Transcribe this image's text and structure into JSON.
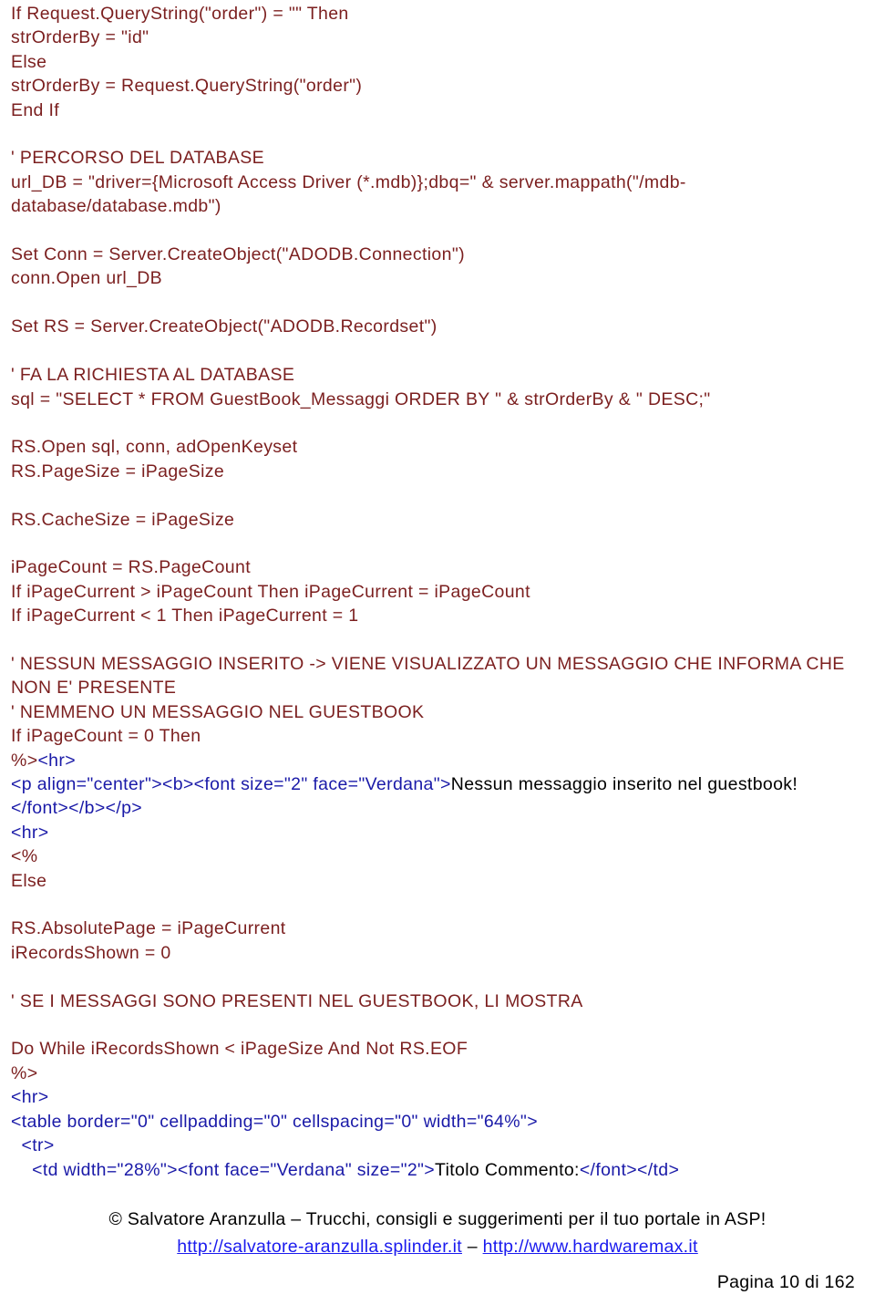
{
  "document": {
    "kind": "asp-code-listing",
    "colors": {
      "vbscript": "#7b1f1f",
      "html_tag": "#1a1aa8",
      "literal_text": "#000000",
      "link": "#1a1aee",
      "background": "#ffffff"
    }
  },
  "code": {
    "lines": [
      {
        "id": "l1",
        "kind": "vbs",
        "text": "If Request.QueryString(\"order\") = \"\" Then"
      },
      {
        "id": "l2",
        "kind": "vbs",
        "text": "strOrderBy = \"id\""
      },
      {
        "id": "l3",
        "kind": "vbs",
        "text": "Else"
      },
      {
        "id": "l4",
        "kind": "vbs",
        "text": "strOrderBy = Request.QueryString(\"order\")"
      },
      {
        "id": "l5",
        "kind": "vbs",
        "text": "End If"
      },
      {
        "id": "l6",
        "kind": "blank",
        "text": ""
      },
      {
        "id": "l7",
        "kind": "vbs",
        "text": "' PERCORSO DEL DATABASE"
      },
      {
        "id": "l8",
        "kind": "vbs",
        "text": "url_DB = \"driver={Microsoft Access Driver (*.mdb)};dbq=\" & server.mappath(\"/mdb-database/database.mdb\")"
      },
      {
        "id": "l9",
        "kind": "blank",
        "text": ""
      },
      {
        "id": "l10",
        "kind": "vbs",
        "text": "Set Conn = Server.CreateObject(\"ADODB.Connection\")"
      },
      {
        "id": "l11",
        "kind": "vbs",
        "text": "conn.Open url_DB"
      },
      {
        "id": "l12",
        "kind": "blank",
        "text": ""
      },
      {
        "id": "l13",
        "kind": "vbs",
        "text": "Set RS = Server.CreateObject(\"ADODB.Recordset\")"
      },
      {
        "id": "l14",
        "kind": "blank",
        "text": ""
      },
      {
        "id": "l15",
        "kind": "vbs",
        "text": "' FA LA RICHIESTA AL DATABASE"
      },
      {
        "id": "l16",
        "kind": "vbs",
        "text": "sql = \"SELECT * FROM GuestBook_Messaggi ORDER BY \" & strOrderBy & \" DESC;\""
      },
      {
        "id": "l17",
        "kind": "blank",
        "text": ""
      },
      {
        "id": "l18",
        "kind": "vbs",
        "text": "RS.Open sql, conn, adOpenKeyset"
      },
      {
        "id": "l19",
        "kind": "vbs",
        "text": "RS.PageSize = iPageSize"
      },
      {
        "id": "l20",
        "kind": "blank",
        "text": ""
      },
      {
        "id": "l21",
        "kind": "vbs",
        "text": "RS.CacheSize = iPageSize"
      },
      {
        "id": "l22",
        "kind": "blank",
        "text": ""
      },
      {
        "id": "l23",
        "kind": "vbs",
        "text": "iPageCount = RS.PageCount"
      },
      {
        "id": "l24",
        "kind": "vbs",
        "text": "If iPageCurrent > iPageCount Then iPageCurrent = iPageCount"
      },
      {
        "id": "l25",
        "kind": "vbs",
        "text": "If iPageCurrent < 1 Then iPageCurrent = 1"
      },
      {
        "id": "l26",
        "kind": "blank",
        "text": ""
      },
      {
        "id": "l27",
        "kind": "vbs",
        "text": "' NESSUN MESSAGGIO INSERITO -> VIENE VISUALIZZATO UN MESSAGGIO CHE INFORMA CHE NON E' PRESENTE"
      },
      {
        "id": "l28",
        "kind": "vbs",
        "text": "' NEMMENO UN MESSAGGIO NEL GUESTBOOK"
      },
      {
        "id": "l29",
        "kind": "vbs",
        "text": "If iPageCount = 0 Then"
      },
      {
        "id": "l30",
        "kind": "mixed",
        "parts": [
          {
            "c": "vbs",
            "t": "%>"
          },
          {
            "c": "html",
            "t": "<hr>"
          }
        ]
      },
      {
        "id": "l31",
        "kind": "mixed",
        "parts": [
          {
            "c": "html",
            "t": "<p align=\"center\"><b><font size=\"2\" face=\"Verdana\">"
          },
          {
            "c": "text",
            "t": "Nessun messaggio inserito nel guestbook!"
          },
          {
            "c": "html",
            "t": "</font></b></p>"
          }
        ]
      },
      {
        "id": "l32",
        "kind": "html",
        "text": "<hr>"
      },
      {
        "id": "l33",
        "kind": "vbs",
        "text": "<%"
      },
      {
        "id": "l34",
        "kind": "vbs",
        "text": "Else"
      },
      {
        "id": "l35",
        "kind": "blank",
        "text": ""
      },
      {
        "id": "l36",
        "kind": "vbs",
        "text": "RS.AbsolutePage = iPageCurrent"
      },
      {
        "id": "l37",
        "kind": "vbs",
        "text": "iRecordsShown = 0"
      },
      {
        "id": "l38",
        "kind": "blank",
        "text": ""
      },
      {
        "id": "l39",
        "kind": "vbs",
        "text": "' SE I MESSAGGI SONO PRESENTI NEL GUESTBOOK, LI MOSTRA"
      },
      {
        "id": "l40",
        "kind": "blank",
        "text": ""
      },
      {
        "id": "l41",
        "kind": "vbs",
        "text": "Do While iRecordsShown < iPageSize And Not RS.EOF"
      },
      {
        "id": "l42",
        "kind": "vbs",
        "text": "%>"
      },
      {
        "id": "l43",
        "kind": "html",
        "text": "<hr>"
      },
      {
        "id": "l44",
        "kind": "html",
        "text": "<table border=\"0\" cellpadding=\"0\" cellspacing=\"0\" width=\"64%\">"
      },
      {
        "id": "l45",
        "kind": "html",
        "text": "  <tr>"
      },
      {
        "id": "l46",
        "kind": "mixed",
        "parts": [
          {
            "c": "html",
            "t": "    <td width=\"28%\"><font face=\"Verdana\" size=\"2\">"
          },
          {
            "c": "text",
            "t": "Titolo Commento:"
          },
          {
            "c": "html",
            "t": "</font></td>"
          }
        ]
      }
    ]
  },
  "footer": {
    "copyright": "© Salvatore Aranzulla – Trucchi, consigli e suggerimenti per il tuo portale in ASP!",
    "link1": "http://salvatore-aranzulla.splinder.it",
    "separator": " – ",
    "link2": "http://www.hardwaremax.it",
    "page_number": "Pagina 10 di 162"
  }
}
